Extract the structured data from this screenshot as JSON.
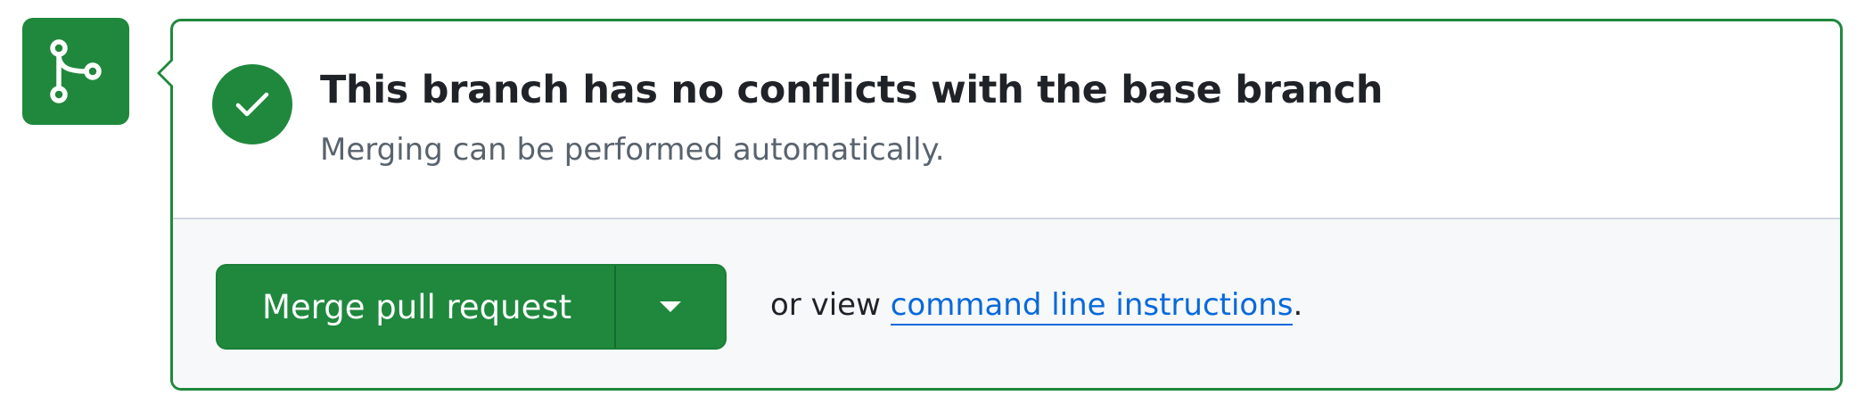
{
  "status": {
    "title": "This branch has no conflicts with the base branch",
    "subtitle": "Merging can be performed automatically."
  },
  "actions": {
    "merge_label": "Merge pull request",
    "prefix_text": "or view",
    "link_text": "command line instructions",
    "suffix_text": "."
  },
  "icons": {
    "timeline": "git-merge-icon",
    "status": "check-circle-icon",
    "dropdown": "triangle-down-icon"
  },
  "colors": {
    "success_green": "#1f883d",
    "link_blue": "#0969da",
    "text_primary": "#1f2328",
    "text_muted": "#59636e",
    "footer_bg": "#f6f8fa"
  }
}
